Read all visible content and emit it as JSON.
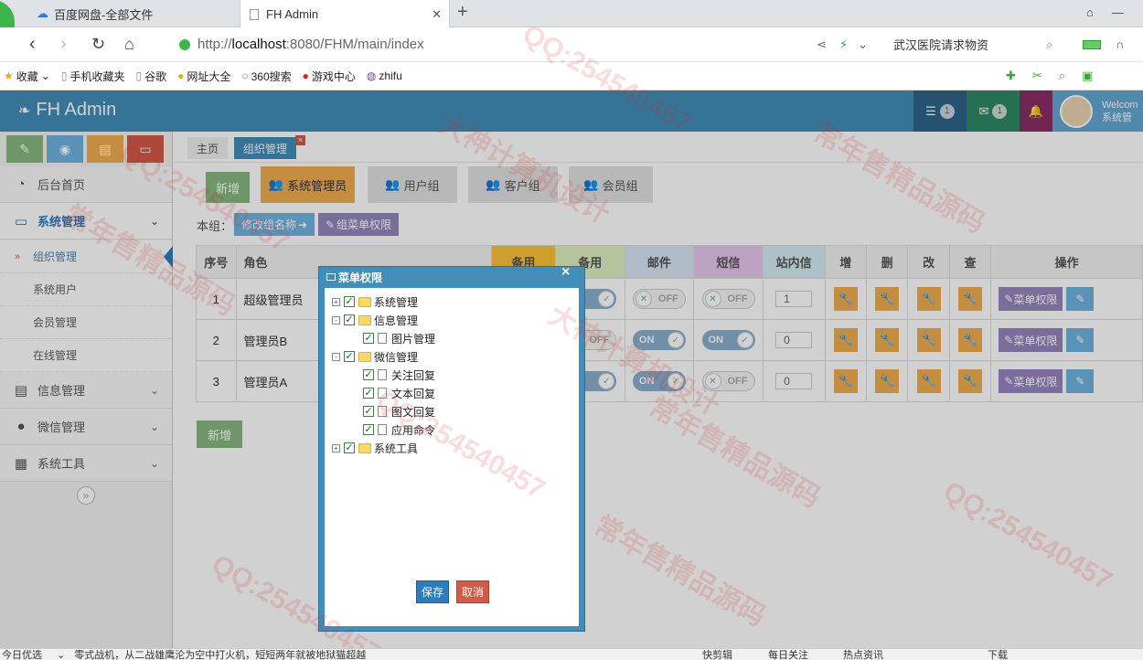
{
  "browser": {
    "tabs": [
      {
        "label": "百度网盘-全部文件",
        "icon": "baidu-cloud-icon"
      },
      {
        "label": "FH Admin",
        "icon": "page-icon"
      }
    ],
    "new_tab": "+",
    "url_scheme": "http://",
    "url_host": "localhost",
    "url_rest": ":8080/FHM/main/index",
    "search_text": "武汉医院请求物资",
    "bookmarks": [
      "收藏",
      "手机收藏夹",
      "谷歌",
      "网址大全",
      "360搜索",
      "游戏中心",
      "zhifu"
    ]
  },
  "app": {
    "logo": "FH Admin",
    "header_badges": {
      "tasks": "1",
      "messages": "1"
    },
    "welcome": "Welcom",
    "user_role": "系统管",
    "colors": {
      "header": "#438eb9",
      "sidebar_bg": "#f2f2f2",
      "accent_purple": "#9585bf"
    }
  },
  "sidebar": {
    "shortcuts": [
      {
        "icon": "pencil-icon",
        "color": "#87b87f"
      },
      {
        "icon": "eye-icon",
        "color": "#6fb3e0"
      },
      {
        "icon": "book-icon",
        "color": "#f0ad4e"
      },
      {
        "icon": "folder-icon",
        "color": "#d15b47"
      }
    ],
    "items": [
      {
        "label": "后台首页",
        "icon": "dashboard-icon"
      },
      {
        "label": "系统管理",
        "icon": "desktop-icon"
      },
      {
        "label": "信息管理",
        "icon": "list-icon"
      },
      {
        "label": "微信管理",
        "icon": "comments-icon"
      },
      {
        "label": "系统工具",
        "icon": "grid-icon"
      }
    ],
    "subitems": [
      "组织管理",
      "系统用户",
      "会员管理",
      "在线管理"
    ],
    "collapse": "»"
  },
  "page_tabs": {
    "home": "主页",
    "current": "组织管理",
    "close": "×"
  },
  "groups": {
    "add": "新增",
    "tabs": [
      "系统管理员",
      "用户组",
      "客户组",
      "会员组"
    ],
    "this_group_label": "本组：",
    "rename": "修改组名称",
    "group_menu": "组菜单权限"
  },
  "table": {
    "headers": [
      "序号",
      "角色",
      "备用",
      "备用",
      "邮件",
      "短信",
      "站内信",
      "增",
      "删",
      "改",
      "查",
      "操作"
    ],
    "rows": [
      {
        "no": "1",
        "role": "超级管理员",
        "b2": "ON",
        "mail": "OFF",
        "sms": "OFF",
        "inbox": "1"
      },
      {
        "no": "2",
        "role": "管理员B",
        "b2": "OFF",
        "mail": "ON",
        "sms": "ON",
        "inbox": "0"
      },
      {
        "no": "3",
        "role": "管理员A",
        "b2": "ON",
        "mail": "ON",
        "sms": "OFF",
        "inbox": "0"
      }
    ],
    "menu_perm": "菜单权限"
  },
  "bottom_add": "新增",
  "dialog": {
    "title": "菜单权限",
    "close": "×",
    "tree": [
      {
        "label": "系统管理",
        "toggle": "+",
        "type": "folder"
      },
      {
        "label": "信息管理",
        "toggle": "-",
        "type": "folder"
      },
      {
        "label": "图片管理",
        "type": "file"
      },
      {
        "label": "微信管理",
        "toggle": "-",
        "type": "folder"
      },
      {
        "label": "关注回复",
        "type": "file"
      },
      {
        "label": "文本回复",
        "type": "file"
      },
      {
        "label": "图文回复",
        "type": "file"
      },
      {
        "label": "应用命令",
        "type": "file"
      },
      {
        "label": "系统工具",
        "toggle": "+",
        "type": "folder"
      }
    ],
    "save": "保存",
    "cancel": "取消"
  },
  "statusbar": {
    "left": "今日优选",
    "news": "零式战机，从二战雄鹰沦为空中打火机，短短两年就被地狱猫超越",
    "items": [
      "快剪辑",
      "每日关注",
      "热点资讯",
      "下载"
    ]
  },
  "watermarks": [
    "QQ:254540457",
    "大神计算机设计",
    "常年售精品源码"
  ]
}
